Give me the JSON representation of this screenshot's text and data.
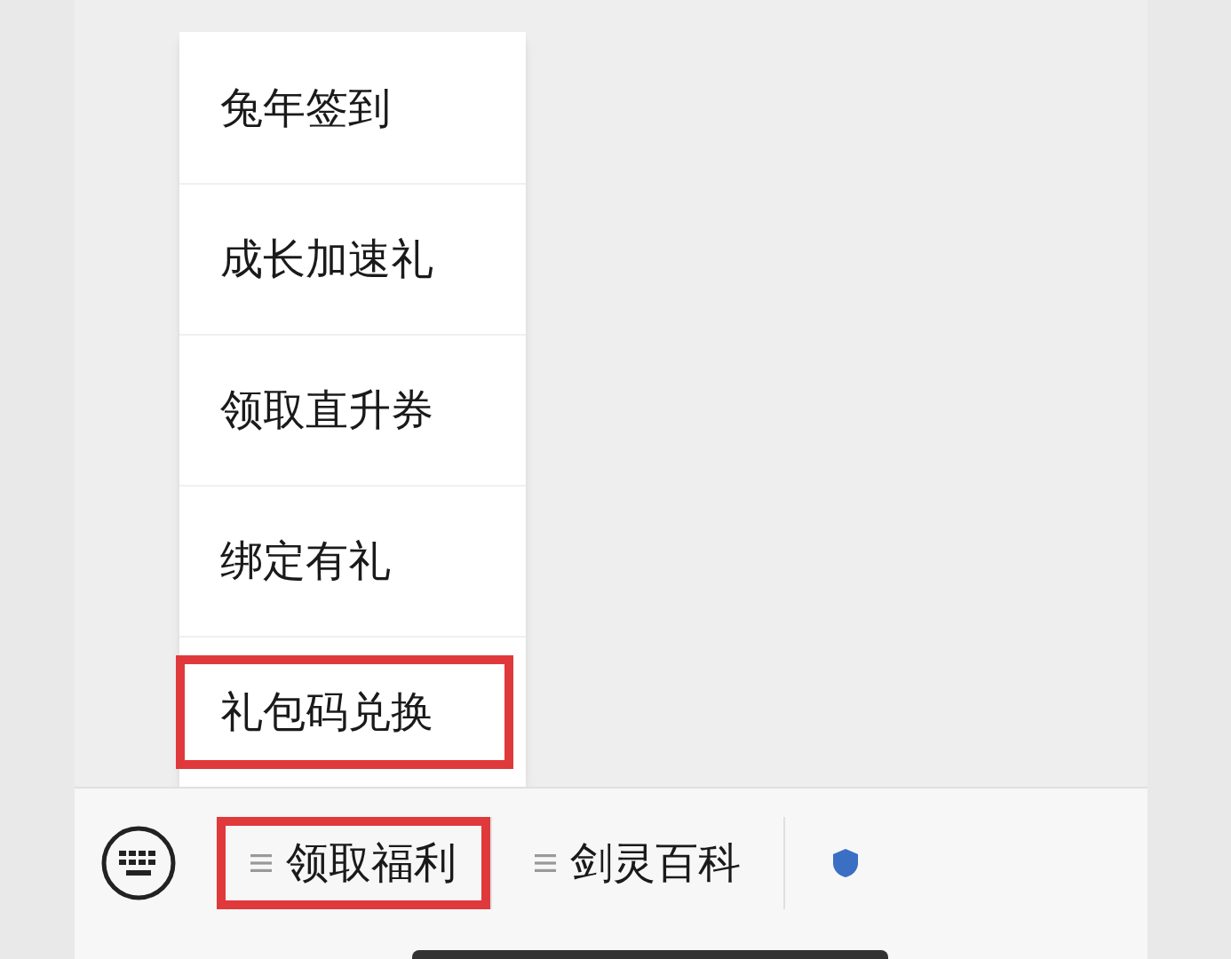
{
  "popup_menu": {
    "items": [
      {
        "label": "兔年签到",
        "highlighted": false
      },
      {
        "label": "成长加速礼",
        "highlighted": false
      },
      {
        "label": "领取直升券",
        "highlighted": false
      },
      {
        "label": "绑定有礼",
        "highlighted": false
      },
      {
        "label": "礼包码兑换",
        "highlighted": true
      }
    ]
  },
  "menu_bar": {
    "tabs": [
      {
        "kind": "text",
        "label": "领取福利",
        "highlighted": true
      },
      {
        "kind": "text",
        "label": "剑灵百科",
        "highlighted": false
      },
      {
        "kind": "icon_only",
        "highlighted": false
      }
    ]
  }
}
